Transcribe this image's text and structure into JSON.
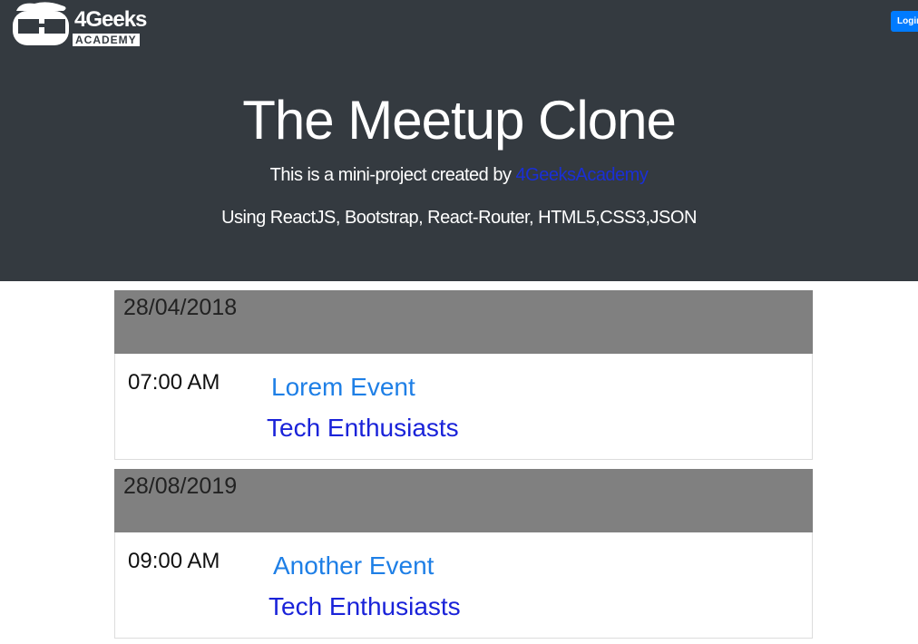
{
  "brand": {
    "wordmark": "4Geeks",
    "subtitle": "ACADEMY"
  },
  "header": {
    "login_label": "Login",
    "title": "The Meetup Clone",
    "subtitle_prefix": "This is a mini-project created by ",
    "subtitle_link": "4GeeksAcademy",
    "tech_line": "Using ReactJS, Bootstrap, React-Router, HTML5,CSS3,JSON"
  },
  "events": [
    {
      "date": "28/04/2018",
      "time": "07:00 AM",
      "title": "Lorem Event",
      "group": "Tech Enthusiasts"
    },
    {
      "date": "28/08/2019",
      "time": "09:00 AM",
      "title": "Another Event",
      "group": "Tech Enthusiasts"
    }
  ],
  "colors": {
    "hero_bg": "#343a40",
    "date_bar_bg": "#808080",
    "event_title": "#1e7fe6",
    "group_link": "#1a23d9",
    "login_button": "#007bff"
  }
}
